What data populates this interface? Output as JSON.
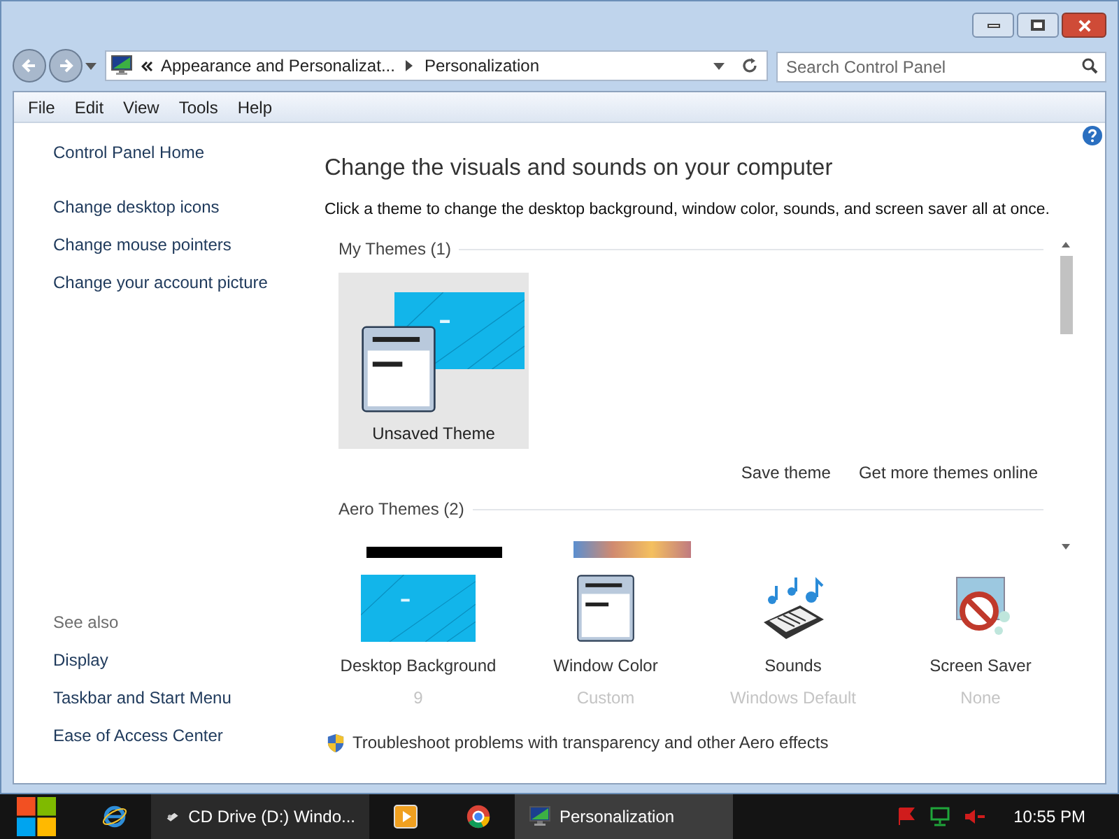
{
  "address": {
    "crumbs": [
      "Appearance and Personalizat...",
      "Personalization"
    ]
  },
  "search": {
    "placeholder": "Search Control Panel"
  },
  "menu": [
    "File",
    "Edit",
    "View",
    "Tools",
    "Help"
  ],
  "sidebar": {
    "home": "Control Panel Home",
    "links": [
      "Change desktop icons",
      "Change mouse pointers",
      "Change your account picture"
    ],
    "see_also_title": "See also",
    "see_also": [
      "Display",
      "Taskbar and Start Menu",
      "Ease of Access Center"
    ]
  },
  "heading": "Change the visuals and sounds on your computer",
  "description": "Click a theme to change the desktop background, window color, sounds, and screen saver all at once.",
  "theme_groups": [
    {
      "title": "My Themes (1)",
      "themes": [
        {
          "kind": "custom",
          "label": "Unsaved Theme",
          "selected": true
        }
      ],
      "actions": [
        "Save theme",
        "Get more themes online"
      ]
    },
    {
      "title": "Aero Themes (2)",
      "themes": [
        {
          "kind": "dark",
          "selected": false
        },
        {
          "kind": "sunset",
          "selected": false
        }
      ]
    }
  ],
  "settings": [
    {
      "kind": "background",
      "label": "Desktop Background",
      "value": "9"
    },
    {
      "kind": "color",
      "label": "Window Color",
      "value": "Custom"
    },
    {
      "kind": "sounds",
      "label": "Sounds",
      "value": "Windows Default"
    },
    {
      "kind": "saver",
      "label": "Screen Saver",
      "value": "None"
    }
  ],
  "troubleshoot": "Troubleshoot problems with transparency and other Aero effects",
  "taskbar": [
    {
      "kind": "ie"
    },
    {
      "kind": "drive",
      "label": "CD Drive (D:) Windo...",
      "selected": false
    },
    {
      "kind": "media"
    },
    {
      "kind": "chrome"
    },
    {
      "kind": "panel",
      "label": "Personalization",
      "selected": true
    }
  ],
  "clock": "10:55 PM"
}
